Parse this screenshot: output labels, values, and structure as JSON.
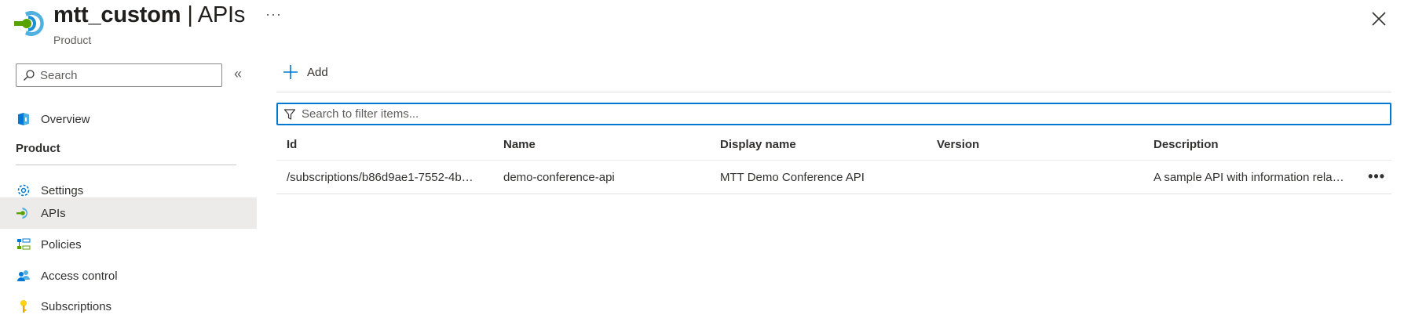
{
  "header": {
    "resource_name": "mtt_custom",
    "separator": "|",
    "page_title": "APIs",
    "subtitle": "Product",
    "more_label": "···",
    "icon": "api-management-icon",
    "close_icon": "close-icon"
  },
  "sidebar": {
    "search_placeholder": "Search",
    "collapse_label": "«",
    "section_title": "Product",
    "items": [
      {
        "label": "Overview",
        "icon": "overview-icon",
        "selected": false
      },
      {
        "label": "Settings",
        "icon": "gear-icon",
        "selected": false
      },
      {
        "label": "APIs",
        "icon": "api-icon",
        "selected": true
      },
      {
        "label": "Policies",
        "icon": "policies-icon",
        "selected": false
      },
      {
        "label": "Access control",
        "icon": "people-icon",
        "selected": false
      },
      {
        "label": "Subscriptions",
        "icon": "key-icon",
        "selected": false
      }
    ]
  },
  "toolbar": {
    "add_label": "Add",
    "add_icon": "plus-icon"
  },
  "filter": {
    "placeholder": "Search to filter items...",
    "icon": "filter-icon"
  },
  "table": {
    "columns": [
      "Id",
      "Name",
      "Display name",
      "Version",
      "Description"
    ],
    "rows": [
      {
        "id": "/subscriptions/b86d9ae1-7552-4b…",
        "name": "demo-conference-api",
        "display_name": "MTT Demo Conference API",
        "version": "",
        "description": "A sample API with information rela…",
        "more_label": "•••"
      }
    ]
  },
  "colors": {
    "accent": "#0078d4",
    "selected_bg": "#edebe9",
    "brand_green": "#57a300",
    "brand_blue": "#50b0e0"
  }
}
